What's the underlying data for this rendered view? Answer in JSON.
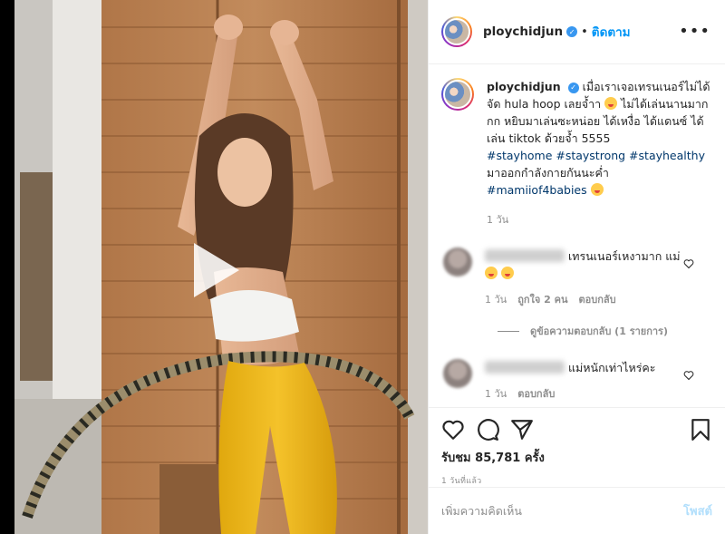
{
  "post": {
    "username": "ploychidjun",
    "follow_label": "ติดตาม",
    "more_label": "•••",
    "separator": "•"
  },
  "caption": {
    "username": "ploychidjun",
    "text_1": "เมื่อเราเจอเทรนเนอร์ไม่ได้ จัด hula hoop เลยจ้ำา",
    "text_2": "ไม่ได้เล่นนานมากกก หยิบมาเล่นซะหน่อย ได้เหงื่อ ได้แดนซ์ ได้เล่น tiktok ด้วยจ้ำ 5555",
    "hashtags_line_1": "#stayhome #staystrong #stayhealthy",
    "text_3": "มาออกกำลังกายกันนะค่ำ",
    "hashtag_last": "#mamiiof4babies",
    "time": "1 วัน"
  },
  "comments": [
    {
      "text": "เทรนเนอร์เหงามาก แม่",
      "time": "1 วัน",
      "likes": "ถูกใจ 2 คน",
      "reply_label": "ตอบกลับ",
      "view_replies": "ดูข้อความตอบกลับ (1 รายการ)"
    },
    {
      "text": "แม่หนักเท่าไหร่คะ",
      "time": "1 วัน",
      "reply_label": "ตอบกลับ"
    }
  ],
  "actions": {
    "views_label": "รับชม 85,781 ครั้ง",
    "posted_time": "1 วันที่แล้ว"
  },
  "comment_box": {
    "placeholder": "เพิ่มความคิดเห็น",
    "post_label": "โพสต์"
  },
  "colors": {
    "link_blue": "#0095f6",
    "hashtag": "#00376b",
    "muted": "#8e8e8e"
  },
  "icons": [
    "play-icon",
    "verified-icon",
    "heart-icon",
    "comment-icon",
    "share-icon",
    "bookmark-icon",
    "more-icon"
  ]
}
